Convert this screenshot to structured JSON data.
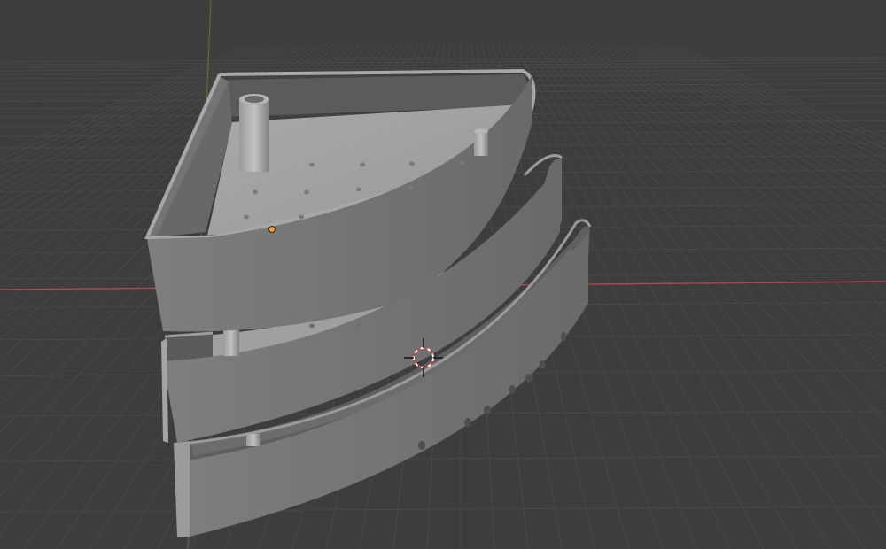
{
  "viewport": {
    "background_color": "#3d3d3d",
    "grid_color": "#4a4a4a",
    "x_axis_color": "#c24b50",
    "y_axis_color": "#6a9a34"
  },
  "model": {
    "shelf_tiers": 3,
    "body_color": "#8e8e8e",
    "inner_floor_color": "#a3a3a3",
    "front_face_color": "#7c7c7c",
    "back_wall_color": "#5c5c5c",
    "side_wall_color": "#6a6a6a",
    "hole_color": "#4f4f4f"
  },
  "origin_marker": {
    "icon": "object-origin-icon",
    "color": "#f0a030"
  },
  "cursor_3d": {
    "icon": "3d-cursor-icon",
    "ring_colors": [
      "#d04040",
      "#ffffff"
    ]
  }
}
